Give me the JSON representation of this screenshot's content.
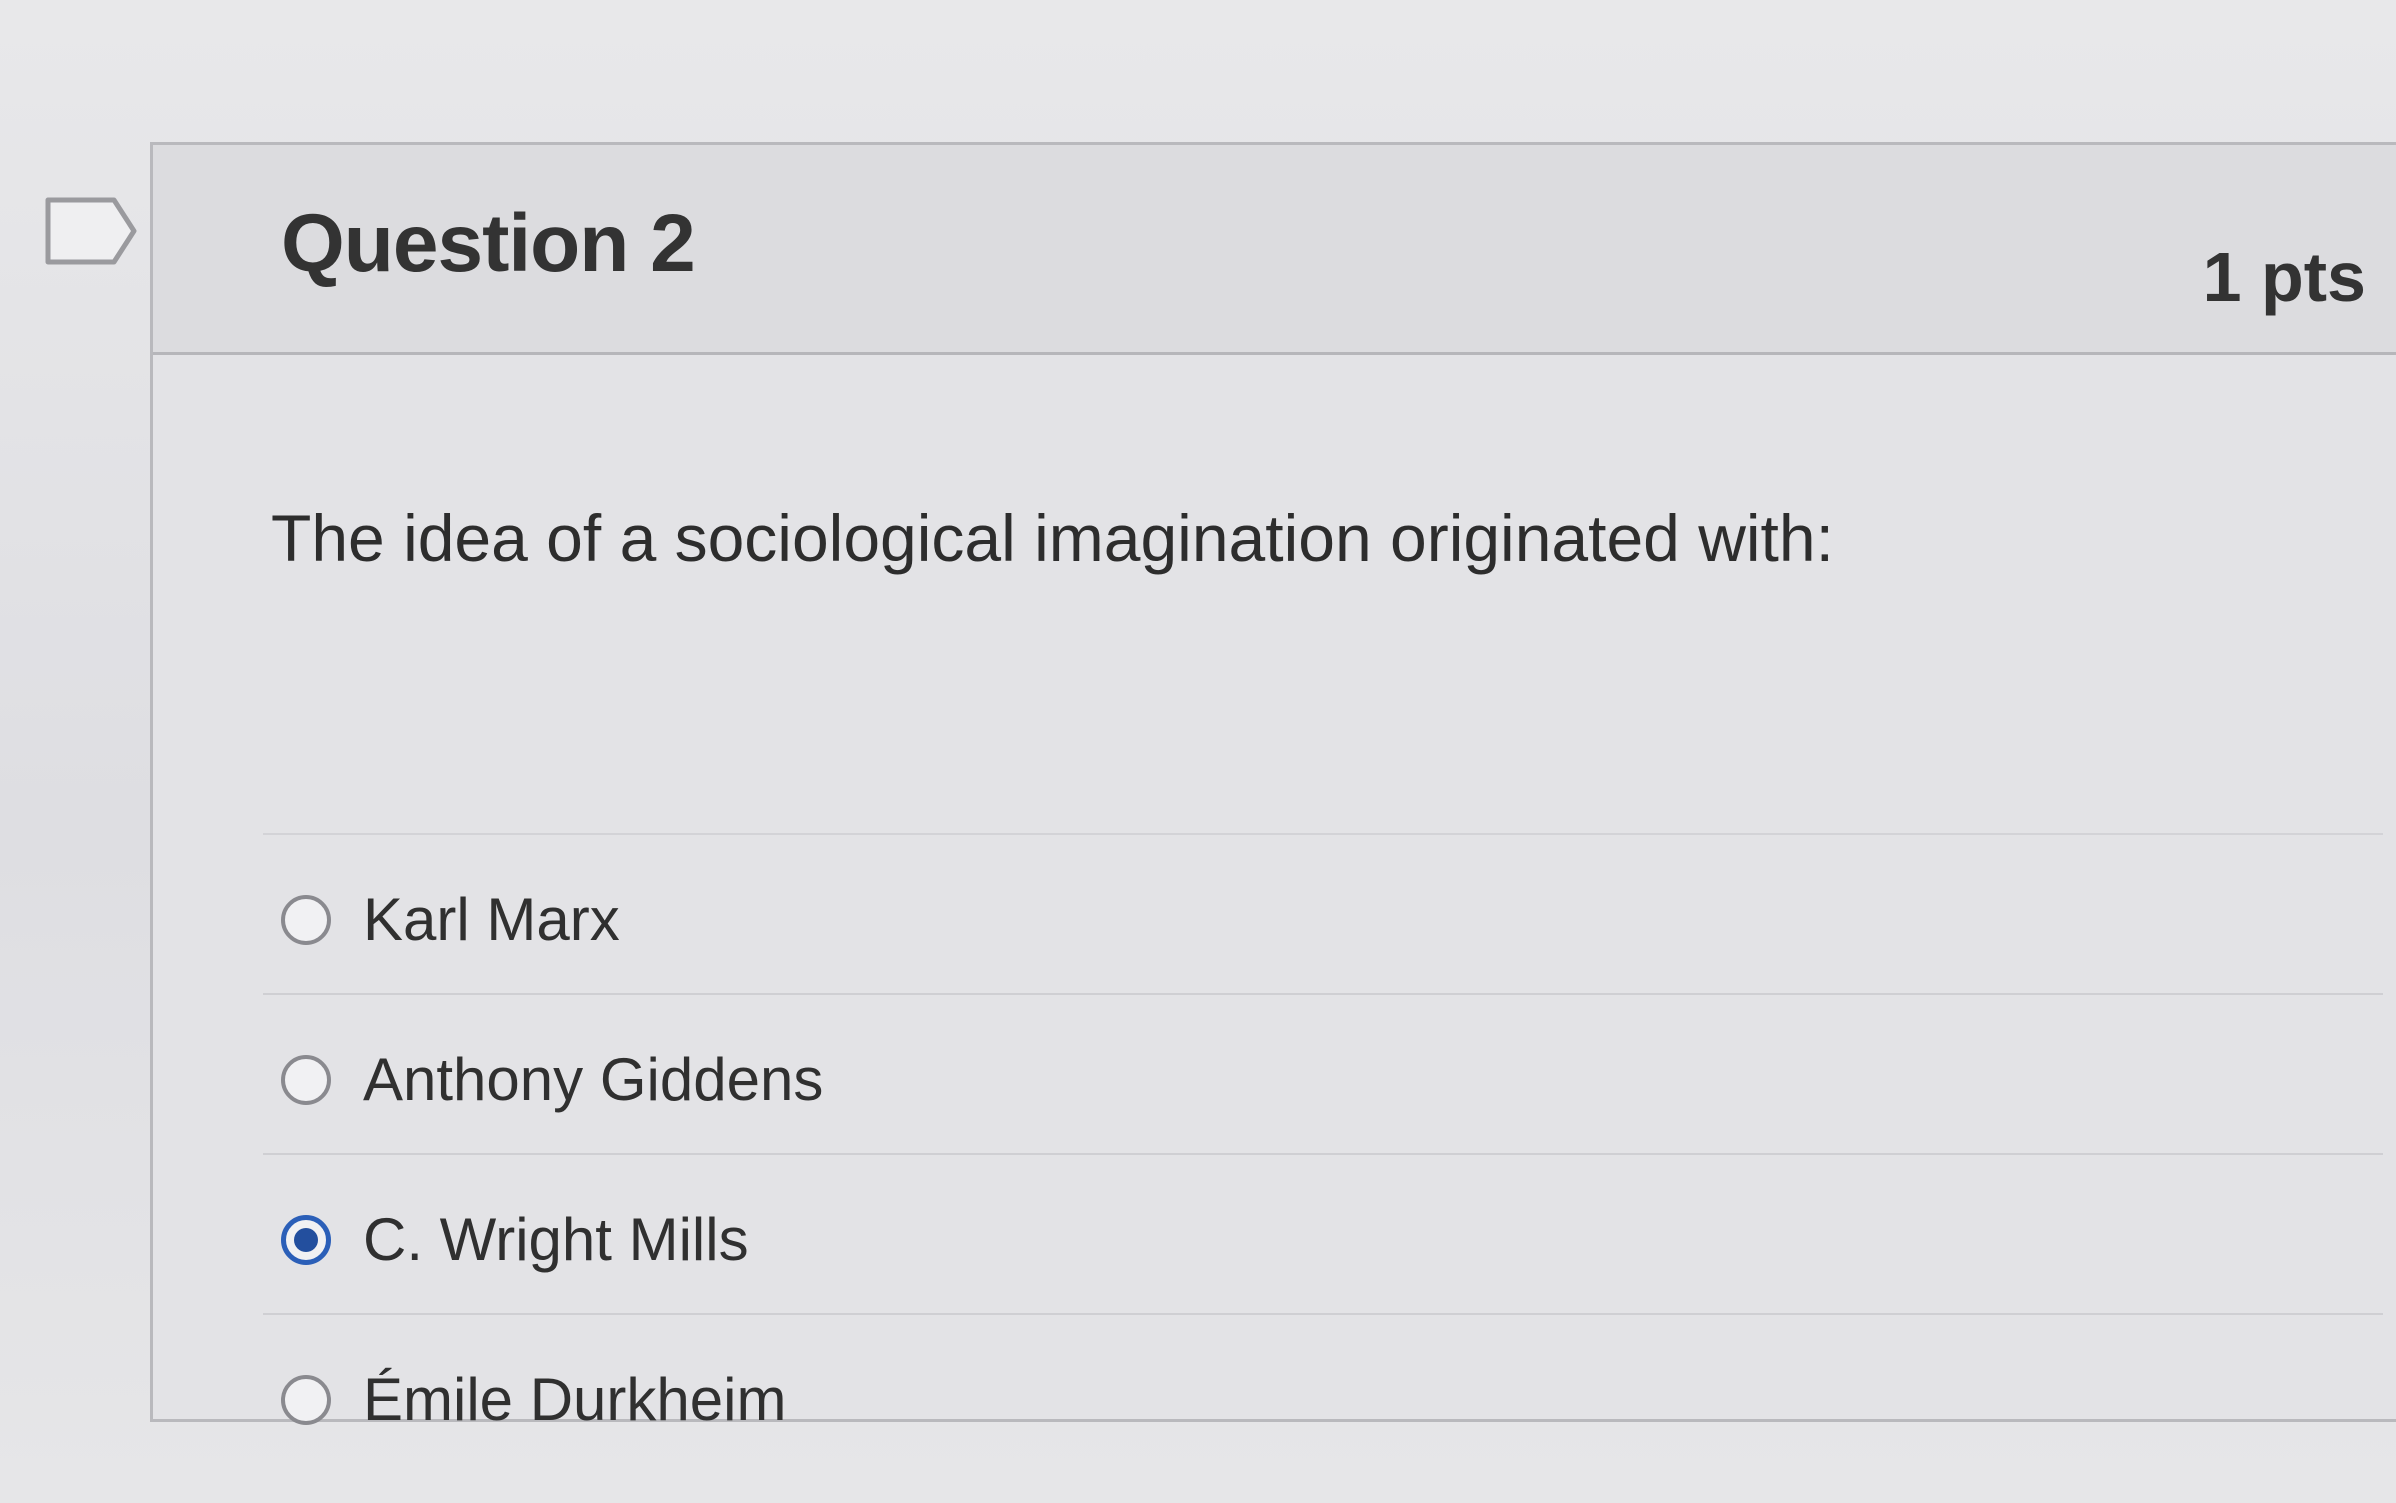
{
  "question": {
    "title": "Question 2",
    "points": "1 pts",
    "text": "The idea of a sociological imagination originated with:"
  },
  "answers": [
    {
      "label": "Karl Marx",
      "selected": false
    },
    {
      "label": "Anthony Giddens",
      "selected": false
    },
    {
      "label": "C. Wright Mills",
      "selected": true
    },
    {
      "label": "Émile Durkheim",
      "selected": false
    }
  ],
  "colors": {
    "selected_radio": "#2b5fb8",
    "text": "#333333"
  }
}
